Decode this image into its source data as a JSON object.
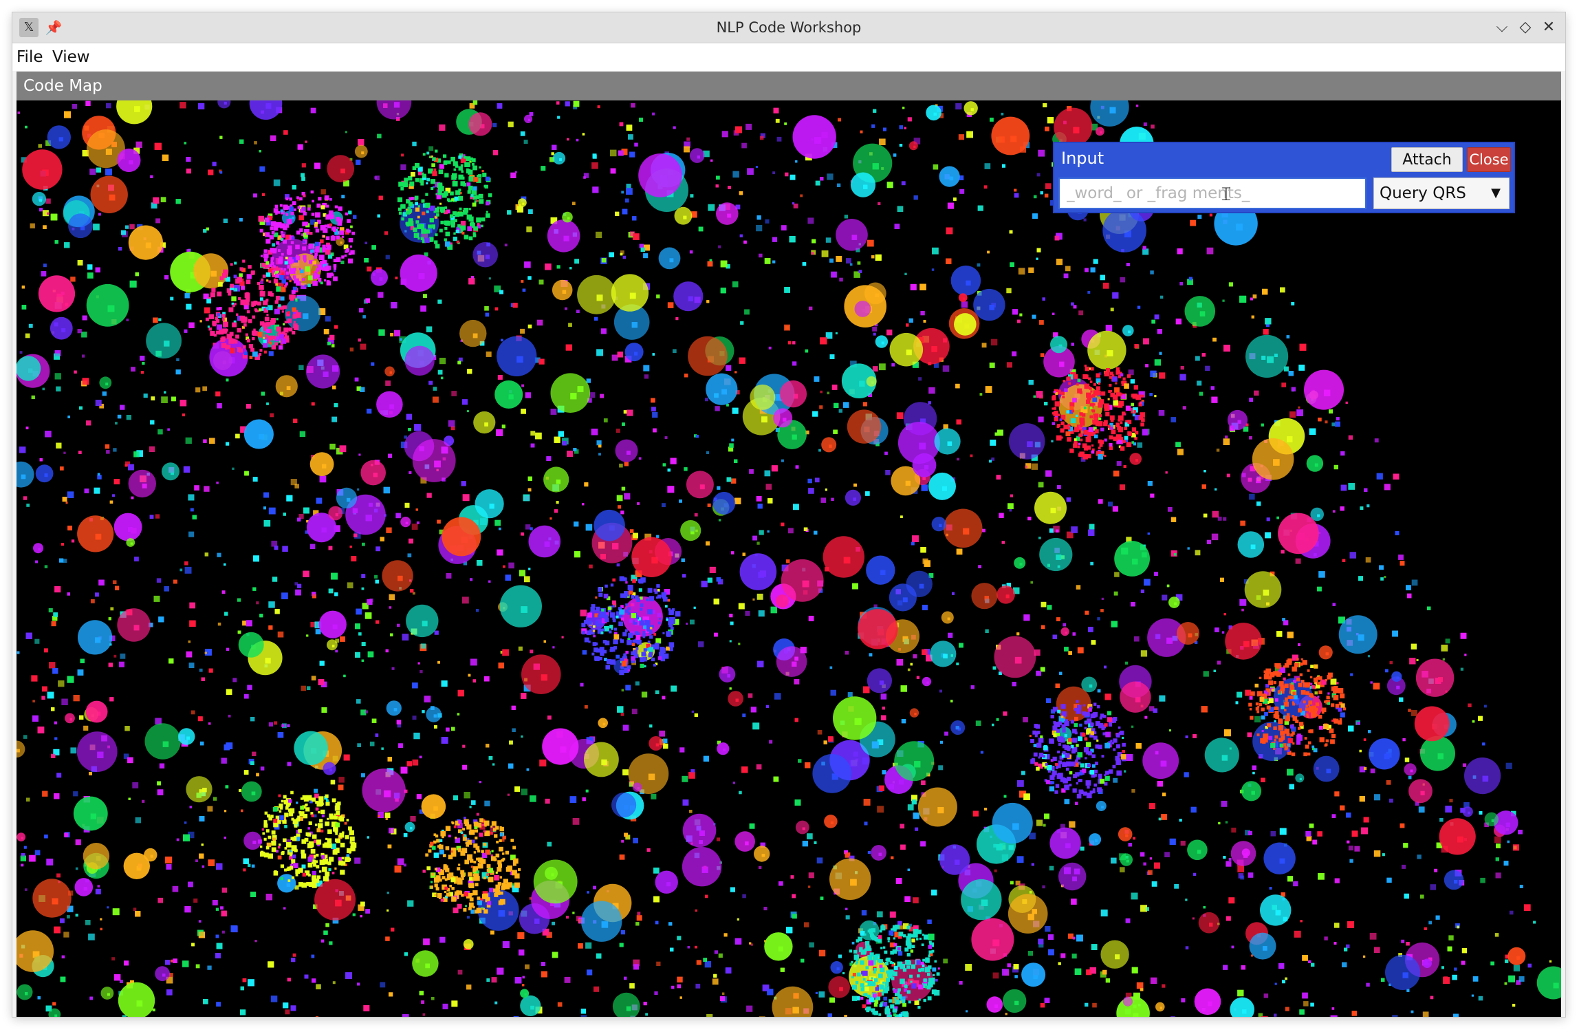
{
  "window": {
    "title": "NLP Code Workshop",
    "app_icon": "x-app-icon",
    "controls": {
      "minimize": "⌵",
      "maximize": "◇",
      "close": "✕"
    }
  },
  "menu": {
    "file": "File",
    "view": "View"
  },
  "panel": {
    "title": "Code Map"
  },
  "input_panel": {
    "title": "Input",
    "attach_label": "Attach",
    "close_label": "Close",
    "field_placeholder": "_word_ or _frag ments_",
    "field_value": "",
    "mode_selected": "Query QRS"
  },
  "colors": {
    "panel_header": "#808080",
    "input_panel_bg": "#2f54d6",
    "close_button": "#c9413a",
    "map_bg": "#000000"
  }
}
